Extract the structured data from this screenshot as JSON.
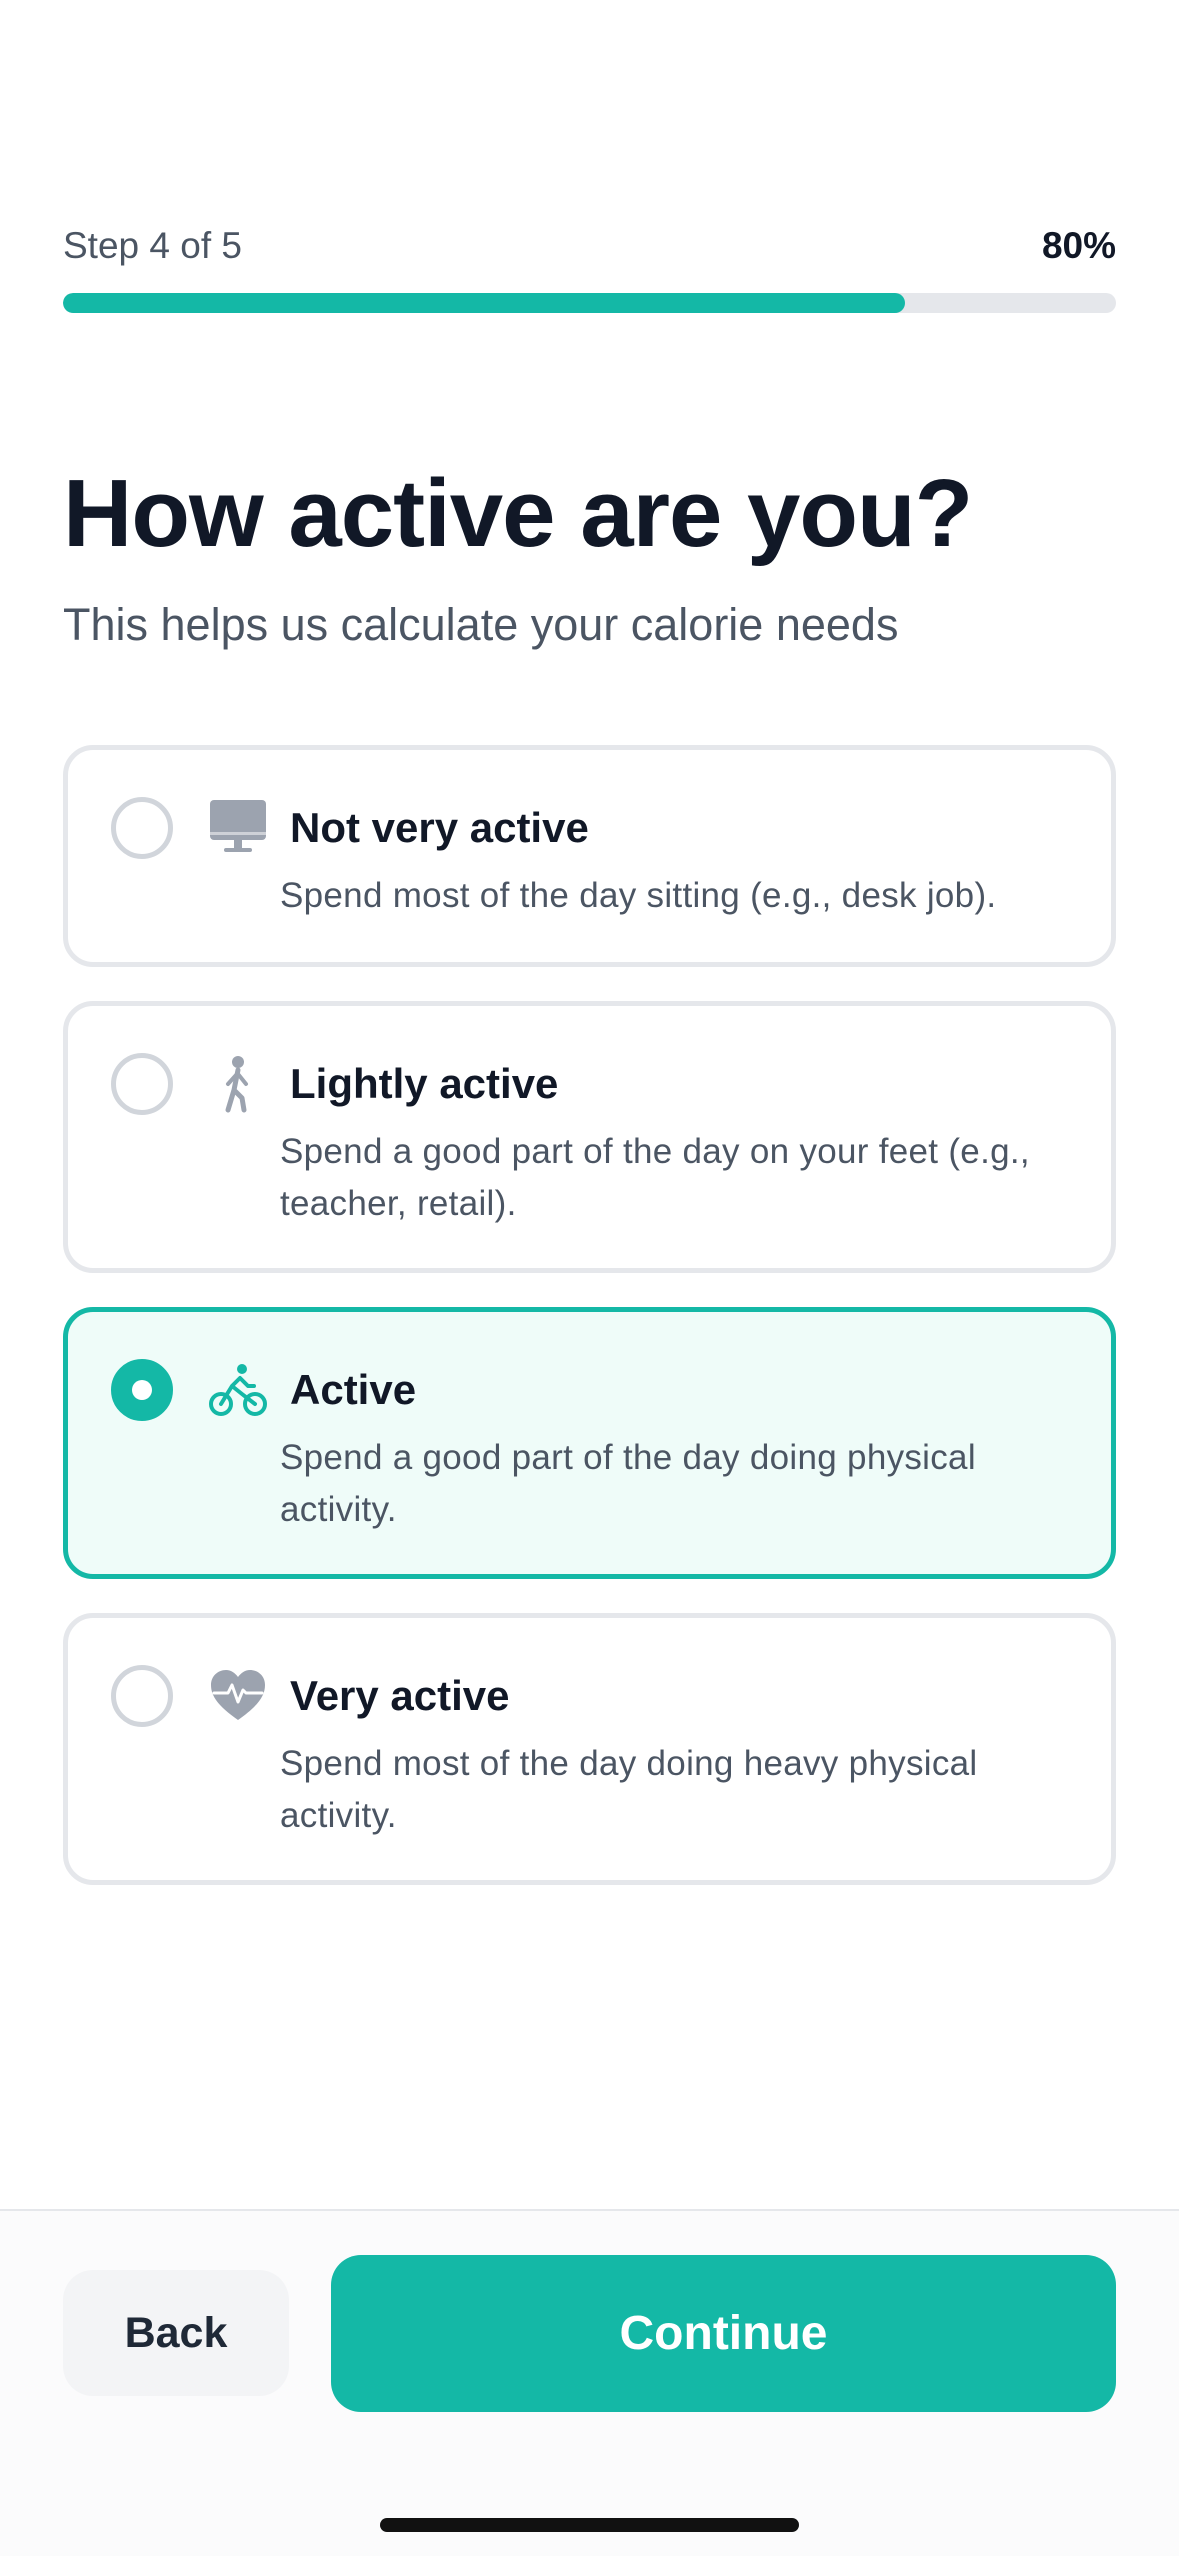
{
  "progress": {
    "step_label": "Step 4 of 5",
    "percent_label": "80%",
    "fraction": 0.8
  },
  "heading": {
    "title": "How active are you?",
    "subtitle": "This helps us calculate your calorie needs"
  },
  "options": [
    {
      "title": "Not very active",
      "description": "Spend most of the day sitting (e.g., desk job).",
      "icon": "desktop-computer-icon",
      "selected": false
    },
    {
      "title": "Lightly active",
      "description": "Spend a good part of the day on your feet (e.g., teacher, retail).",
      "icon": "walking-person-icon",
      "selected": false
    },
    {
      "title": "Active",
      "description": "Spend a good part of the day doing physical activity.",
      "icon": "cyclist-icon",
      "selected": true
    },
    {
      "title": "Very active",
      "description": "Spend most of the day doing heavy physical activity.",
      "icon": "heart-pulse-icon",
      "selected": false
    }
  ],
  "footer": {
    "back_label": "Back",
    "continue_label": "Continue"
  },
  "colors": {
    "accent": "#14b8a6",
    "selected_bg": "#effcf9",
    "border": "#e5e7eb",
    "icon_gray": "#9ca3af"
  }
}
